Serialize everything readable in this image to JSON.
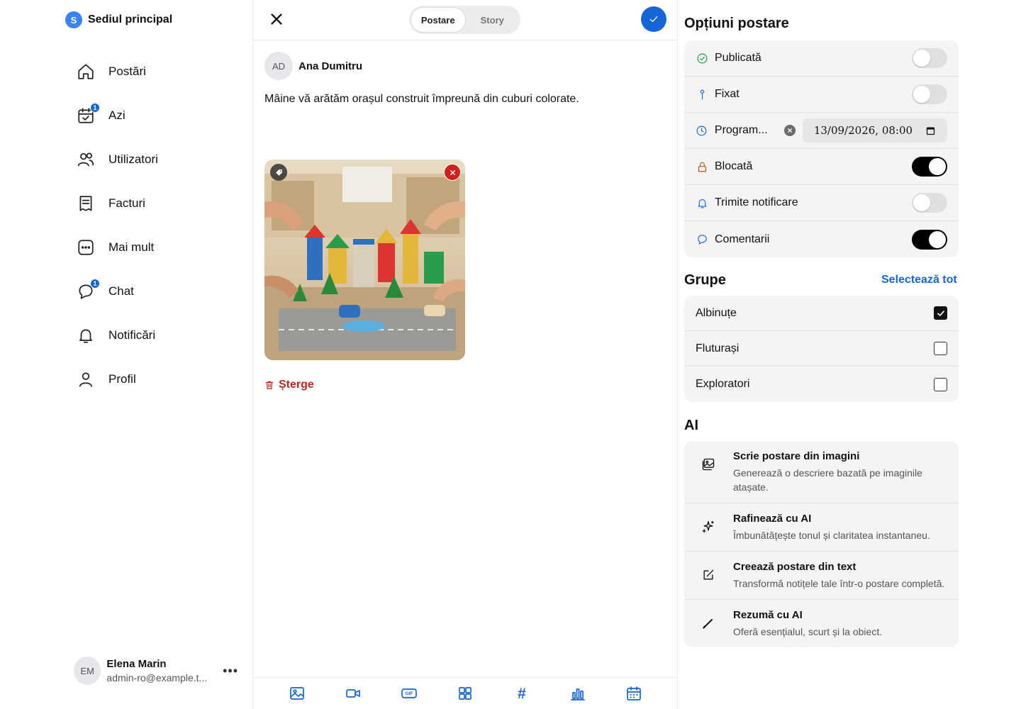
{
  "sidebar": {
    "org": {
      "badge": "S",
      "name": "Sediul principal"
    },
    "items": [
      {
        "label": "Postări",
        "icon": "home-icon"
      },
      {
        "label": "Azi",
        "icon": "calendar-check-icon",
        "badge": "1"
      },
      {
        "label": "Utilizatori",
        "icon": "users-icon"
      },
      {
        "label": "Facturi",
        "icon": "receipt-icon"
      },
      {
        "label": "Mai mult",
        "icon": "more-box-icon"
      },
      {
        "label": "Chat",
        "icon": "chat-icon",
        "badge": "1"
      },
      {
        "label": "Notificări",
        "icon": "bell-icon"
      },
      {
        "label": "Profil",
        "icon": "user-icon"
      }
    ],
    "user": {
      "initials": "EM",
      "name": "Elena Marin",
      "email": "admin-ro@example.t...",
      "more": "•••"
    }
  },
  "editor": {
    "tabs": [
      "Postare",
      "Story"
    ],
    "active_tab": "Postare",
    "author": {
      "initials": "AD",
      "name": "Ana Dumitru"
    },
    "text": "Mâine vă arătăm orașul construit împreună din cuburi colorate.",
    "delete_label": "Șterge",
    "toolbar": [
      "image-icon",
      "video-icon",
      "gif-icon",
      "grid-icon",
      "hashtag-icon",
      "poll-icon",
      "calendar-icon"
    ],
    "gif_text": "GIF",
    "hashtag_text": "#"
  },
  "options": {
    "title": "Opțiuni postare",
    "rows": [
      {
        "label": "Publicată",
        "icon": "check-circle-icon",
        "on": false
      },
      {
        "label": "Fixat",
        "icon": "pin-icon",
        "on": false
      },
      {
        "label": "Blocată",
        "icon": "lock-icon",
        "on": true
      },
      {
        "label": "Trimite notificare",
        "icon": "bell-icon",
        "on": false
      },
      {
        "label": "Comentarii",
        "icon": "comment-icon",
        "on": true
      }
    ],
    "schedule": {
      "label": "Program...",
      "value": "13/09/2026, 08:00",
      "icon": "clock-icon"
    }
  },
  "groups": {
    "title": "Grupe",
    "select_all": "Selectează tot",
    "items": [
      {
        "label": "Albinuțe",
        "checked": true
      },
      {
        "label": "Fluturași",
        "checked": false
      },
      {
        "label": "Exploratori",
        "checked": false
      }
    ]
  },
  "ai": {
    "title": "AI",
    "items": [
      {
        "title": "Scrie postare din imagini",
        "desc": "Generează o descriere bazată pe imaginile atașate.",
        "icon": "image-text-icon"
      },
      {
        "title": "Rafinează cu AI",
        "desc": "Îmbunătățește tonul și claritatea instantaneu.",
        "icon": "sparkles-icon"
      },
      {
        "title": "Creează postare din text",
        "desc": "Transformă notițele tale într-o postare completă.",
        "icon": "edit-box-icon"
      },
      {
        "title": "Rezumă cu AI",
        "desc": "Oferă esențialul, scurt și la obiect.",
        "icon": "pen-icon"
      }
    ]
  },
  "colors": {
    "accent": "#1565d8",
    "danger": "#c0281f",
    "toggle_on": "#000000"
  }
}
